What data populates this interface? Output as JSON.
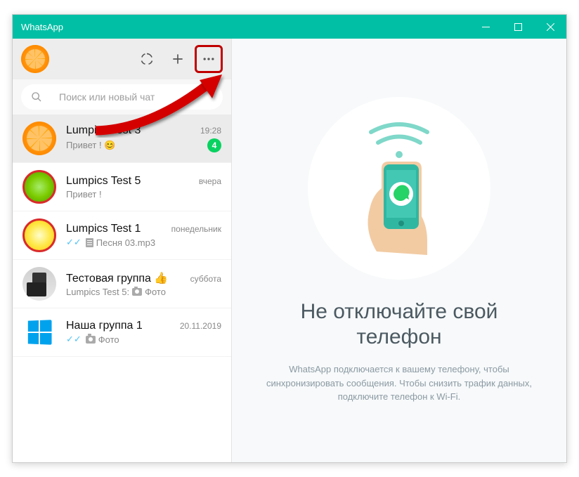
{
  "window": {
    "title": "WhatsApp"
  },
  "search": {
    "placeholder": "Поиск или новый чат"
  },
  "chats": [
    {
      "name": "Lumpics Test 3",
      "time": "19:28",
      "preview": "Привет ! 😊",
      "unread": "4",
      "avatar": "orange",
      "active": true
    },
    {
      "name": "Lumpics Test 5",
      "time": "вчера",
      "preview": "Привет !",
      "avatar": "lime"
    },
    {
      "name": "Lumpics Test 1",
      "time": "понедельник",
      "preview_prefix_ticks": "blue",
      "preview_icon": "doc",
      "preview": "Песня 03.mp3",
      "avatar": "lemon"
    },
    {
      "name": "Тестовая группа 👍",
      "time": "суббота",
      "preview_sender": "Lumpics Test 5:",
      "preview_icon": "cam",
      "preview": "Фото",
      "avatar": "group"
    },
    {
      "name": "Наша группа 1",
      "time": "20.11.2019",
      "preview_prefix_ticks": "blue",
      "preview_icon": "cam",
      "preview": "Фото",
      "avatar": "windows"
    }
  ],
  "main": {
    "title": "Не отключайте свой телефон",
    "desc": "WhatsApp подключается к вашему телефону, чтобы синхронизировать сообщения. Чтобы снизить трафик данных, подключите телефон к Wi-Fi."
  }
}
